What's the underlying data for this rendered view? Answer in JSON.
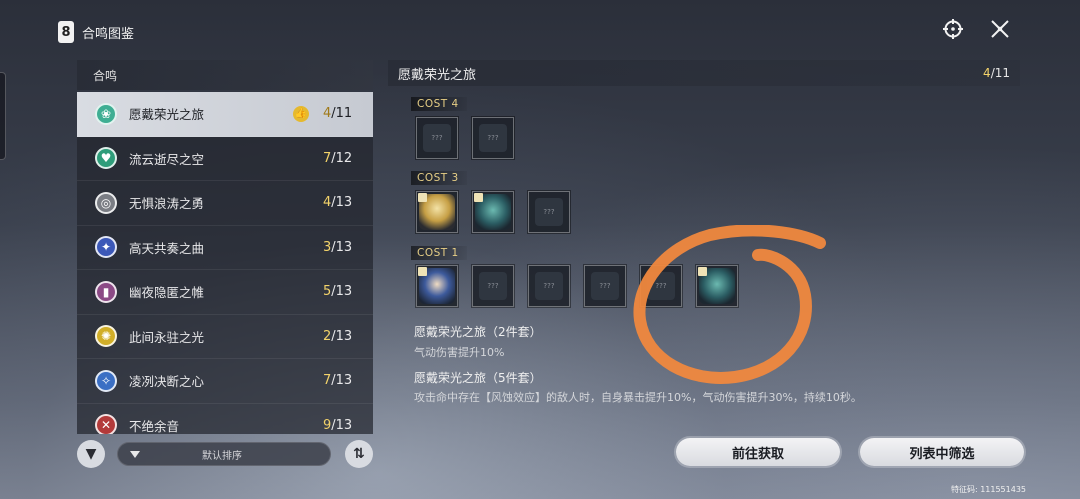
{
  "window": {
    "title": "合鸣图鉴",
    "app_icon_glyph": "8"
  },
  "left_panel": {
    "header": "合鸣",
    "items": [
      {
        "name": "愿戴荣光之旅",
        "count_owned": "4",
        "count_total": "/11",
        "icon": "leaf-emblem-icon",
        "icon_color": "#3fae93",
        "glyph": "❀",
        "selected": true,
        "thumb": true
      },
      {
        "name": "流云逝尽之空",
        "count_owned": "7",
        "count_total": "/12",
        "icon": "wind-emblem-icon",
        "icon_color": "#2f9d7a",
        "glyph": "♥",
        "selected": false
      },
      {
        "name": "无惧浪涛之勇",
        "count_owned": "4",
        "count_total": "/13",
        "icon": "wave-emblem-icon",
        "icon_color": "#7a7d84",
        "glyph": "◎",
        "selected": false
      },
      {
        "name": "高天共奏之曲",
        "count_owned": "3",
        "count_total": "/13",
        "icon": "star-emblem-icon",
        "icon_color": "#3c58b8",
        "glyph": "✦",
        "selected": false
      },
      {
        "name": "幽夜隐匿之帷",
        "count_owned": "5",
        "count_total": "/13",
        "icon": "veil-emblem-icon",
        "icon_color": "#8c4a86",
        "glyph": "▮",
        "selected": false
      },
      {
        "name": "此间永驻之光",
        "count_owned": "2",
        "count_total": "/13",
        "icon": "sun-emblem-icon",
        "icon_color": "#d1ae28",
        "glyph": "✺",
        "selected": false
      },
      {
        "name": "凌冽决断之心",
        "count_owned": "7",
        "count_total": "/13",
        "icon": "compass-emblem-icon",
        "icon_color": "#3b6fc4",
        "glyph": "✧",
        "selected": false
      },
      {
        "name": "不绝余音",
        "count_owned": "9",
        "count_total": "/13",
        "icon": "echo-emblem-icon",
        "icon_color": "#b33a3a",
        "glyph": "✕",
        "selected": false
      }
    ],
    "sort": {
      "label": "默认排序"
    }
  },
  "right_panel": {
    "title": "愿戴荣光之旅",
    "count_owned": "4",
    "count_total": "/11",
    "cost_groups": [
      {
        "label": "COST 4",
        "slots": [
          "???",
          "???"
        ]
      },
      {
        "label": "COST 3",
        "slots": [
          "gold",
          "echo",
          "???"
        ]
      },
      {
        "label": "COST 1",
        "slots": [
          "nun",
          "???",
          "???",
          "???",
          "???",
          "echo"
        ]
      }
    ],
    "set_bonuses": [
      {
        "title": "愿戴荣光之旅（2件套）",
        "desc": "气动伤害提升10%"
      },
      {
        "title": "愿戴荣光之旅（5件套）",
        "desc": "攻击命中存在【风蚀效应】的敌人时，自身暴击提升10%，气动伤害提升30%，持续10秒。"
      }
    ],
    "unknown_label": "???"
  },
  "actions": {
    "goto_label": "前往获取",
    "filter_label": "列表中筛选"
  },
  "footer": {
    "code": "特征码: 111551435"
  },
  "colors": {
    "accent_gold": "#f3d36a",
    "annotation": "#f0883e"
  }
}
